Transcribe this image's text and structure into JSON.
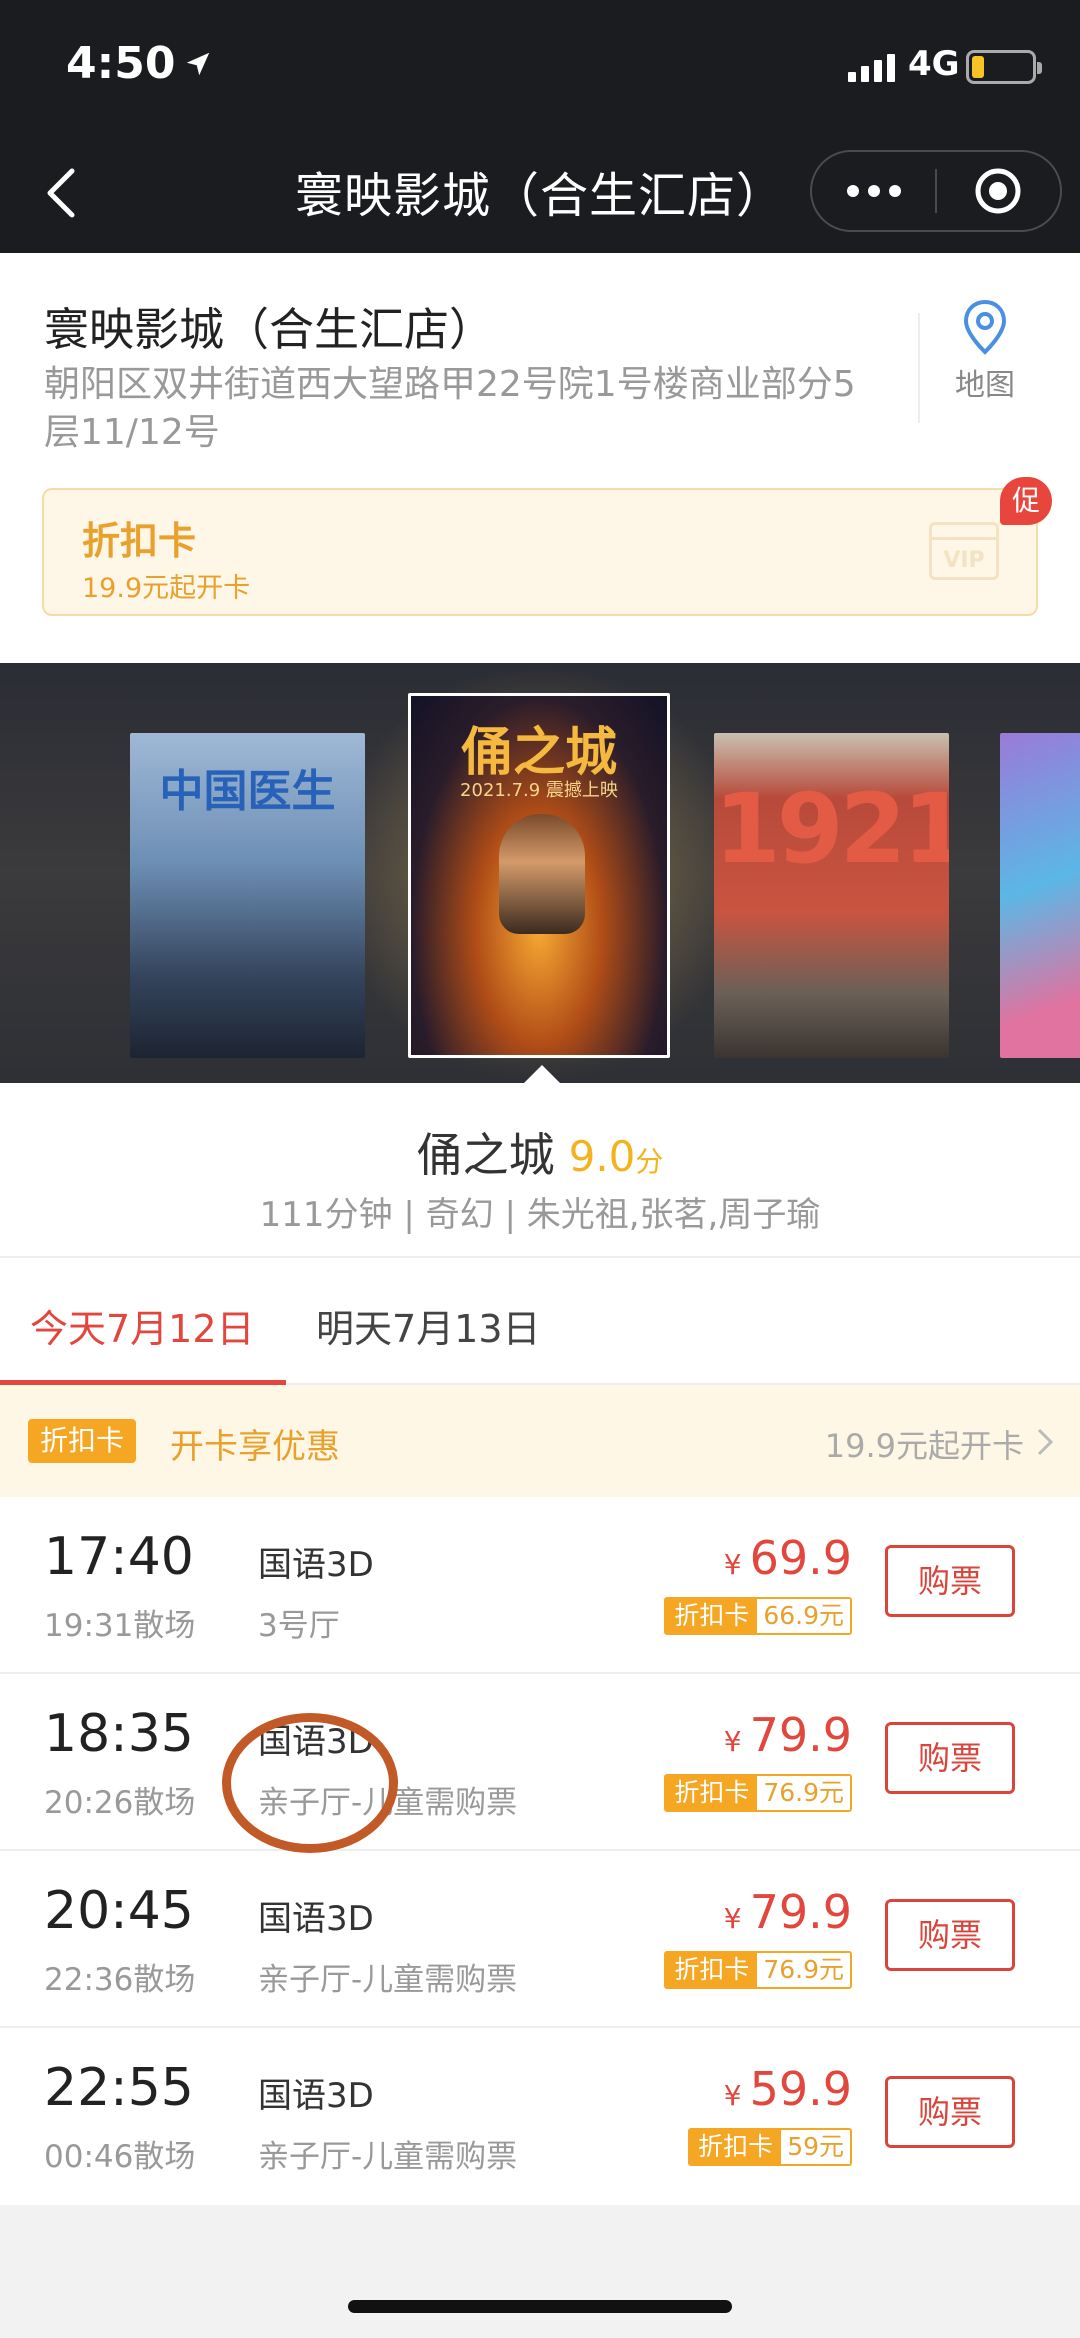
{
  "status_bar": {
    "time": "4:50",
    "network": "4G",
    "battery_level": 0.15,
    "battery_color": "#f7c325"
  },
  "nav": {
    "title": "寰映影城（合生汇店）",
    "back_icon": "chevron-left-icon",
    "more_icon": "more-dots-icon",
    "close_icon": "target-icon"
  },
  "cinema": {
    "name": "寰映影城（合生汇店）",
    "address": "朝阳区双井街道西大望路甲22号院1号楼商业部分5层11/12号",
    "map_label": "地图",
    "map_icon": "location-pin-icon"
  },
  "discount_card": {
    "title": "折扣卡",
    "subtitle": "19.9元起开卡",
    "badge": "促",
    "graphic_text": "VIP",
    "accent_color": "#e8a12d"
  },
  "posters": [
    {
      "title": "中国医生"
    },
    {
      "title": "俑之城",
      "date_text": "2021.7.9 震撼上映",
      "selected": true
    },
    {
      "title": "1921"
    },
    {
      "title": ""
    }
  ],
  "movie": {
    "name": "俑之城",
    "score": "9.0",
    "score_unit": "分",
    "meta": "111分钟 | 奇幻 | 朱光祖,张茗,周子瑜"
  },
  "date_tabs": [
    {
      "label": "今天7月12日",
      "active": true
    },
    {
      "label": "明天7月13日",
      "active": false
    }
  ],
  "discount_row": {
    "tag": "折扣卡",
    "text": "开卡享优惠",
    "right_text": "19.9元起开卡"
  },
  "currency_symbol": "¥",
  "card_label": "折扣卡",
  "buy_label": "购票",
  "showtimes": [
    {
      "start": "17:40",
      "end": "19:31散场",
      "lang": "国语3D",
      "hall": "3号厅",
      "price": "69.9",
      "card_price": "66.9元"
    },
    {
      "start": "18:35",
      "end": "20:26散场",
      "lang": "国语3D",
      "hall": "亲子厅-儿童需购票",
      "price": "79.9",
      "card_price": "76.9元"
    },
    {
      "start": "20:45",
      "end": "22:36散场",
      "lang": "国语3D",
      "hall": "亲子厅-儿童需购票",
      "price": "79.9",
      "card_price": "76.9元"
    },
    {
      "start": "22:55",
      "end": "00:46散场",
      "lang": "国语3D",
      "hall": "亲子厅-儿童需购票",
      "price": "59.9",
      "card_price": "59元"
    }
  ],
  "colors": {
    "header_bg": "#1b1c20",
    "price_red": "#e2473d",
    "tab_active": "#e2473d",
    "annotation": "#c25a28"
  }
}
